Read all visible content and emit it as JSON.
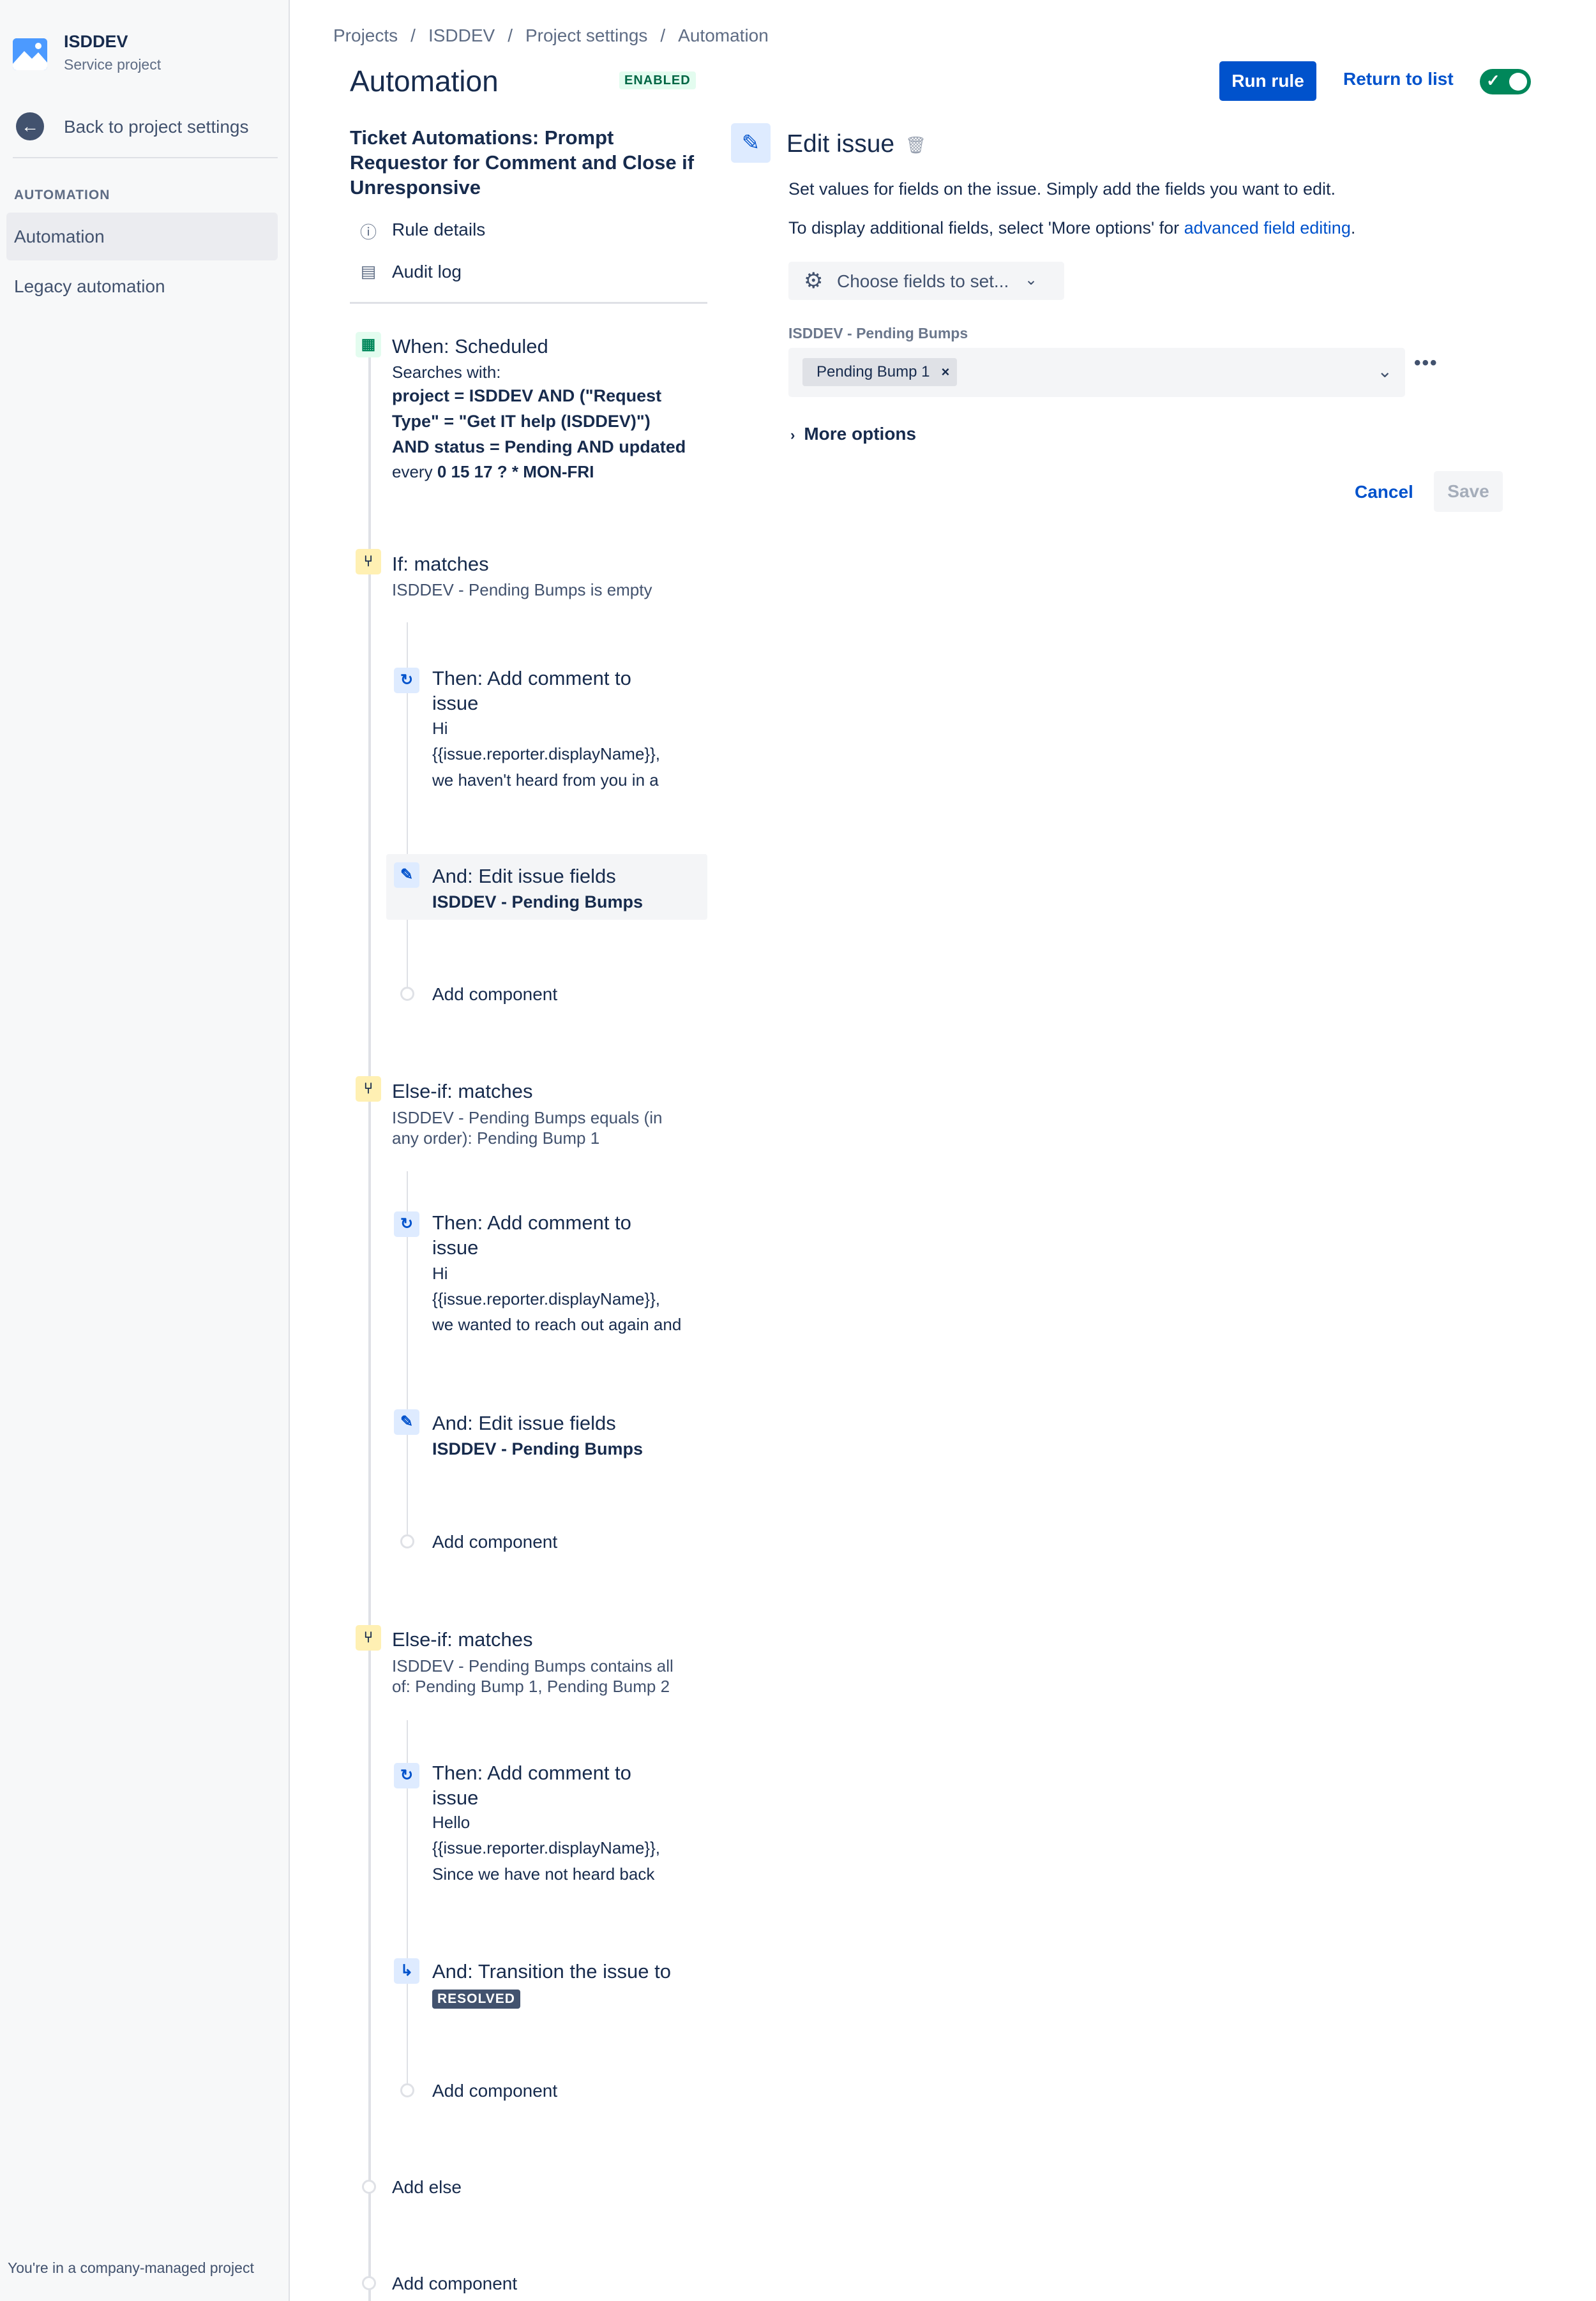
{
  "sidebar": {
    "project_name": "ISDDEV",
    "project_type": "Service project",
    "back_label": "Back to project settings",
    "section_label": "AUTOMATION",
    "items": [
      {
        "label": "Automation",
        "active": true
      },
      {
        "label": "Legacy automation",
        "active": false
      }
    ],
    "footer": "You're in a company-managed project"
  },
  "breadcrumbs": [
    "Projects",
    "ISDDEV",
    "Project settings",
    "Automation"
  ],
  "header": {
    "title": "Automation",
    "status_badge": "ENABLED",
    "run_rule_label": "Run rule",
    "return_label": "Return to list",
    "toggle_on": true
  },
  "rule": {
    "name": "Ticket Automations: Prompt Requestor for Comment and Close if Unresponsive",
    "meta": [
      {
        "icon": "info-icon",
        "label": "Rule details"
      },
      {
        "icon": "audit-log-icon",
        "label": "Audit log"
      }
    ],
    "trigger": {
      "title": "When: Scheduled",
      "searches_label": "Searches with:",
      "jql_line1": "project = ISDDEV AND (\"Request",
      "jql_line2": "Type\" = \"Get IT help (ISDDEV)\")",
      "jql_line3": "AND status = Pending AND updated",
      "every_prefix": "every",
      "cron": "0 15 17 ? * MON-FRI"
    },
    "branch1": {
      "title": "If: matches",
      "desc": "ISDDEV - Pending Bumps is empty",
      "action1_title_1": "Then: Add comment to",
      "action1_title_2": "issue",
      "action1_l1": "Hi",
      "action1_l2": "{{issue.reporter.displayName}},",
      "action1_l3": "we haven't heard from you in a",
      "action2_title": "And: Edit issue fields",
      "action2_field": "ISDDEV - Pending Bumps",
      "add_component": "Add component"
    },
    "branch2": {
      "title": "Else-if: matches",
      "desc_1": "ISDDEV - Pending Bumps equals (in",
      "desc_2": "any order): Pending Bump 1",
      "action1_title_1": "Then: Add comment to",
      "action1_title_2": "issue",
      "action1_l1": "Hi",
      "action1_l2": "{{issue.reporter.displayName}},",
      "action1_l3": "we wanted to reach out again and",
      "action2_title": "And: Edit issue fields",
      "action2_field": "ISDDEV - Pending Bumps",
      "add_component": "Add component"
    },
    "branch3": {
      "title": "Else-if: matches",
      "desc_1": "ISDDEV - Pending Bumps contains all",
      "desc_2": "of: Pending Bump 1, Pending Bump 2",
      "action1_title_1": "Then: Add comment to",
      "action1_title_2": "issue",
      "action1_l1": "Hello",
      "action1_l2": "{{issue.reporter.displayName}},",
      "action1_l3": "Since we have not heard back",
      "action2_title": "And: Transition the issue to",
      "action2_status": "RESOLVED",
      "add_component": "Add component"
    },
    "add_else": "Add else",
    "add_component_root": "Add component"
  },
  "edit_panel": {
    "title": "Edit issue",
    "desc1": "Set values for fields on the issue. Simply add the fields you want to edit.",
    "desc2_prefix": "To display additional fields, select 'More options' for ",
    "desc2_link": "advanced field editing",
    "desc2_suffix": ".",
    "choose_fields_label": "Choose fields to set...",
    "field_label": "ISDDEV - Pending Bumps",
    "field_value_chip": "Pending Bump 1",
    "more_options_label": "More options",
    "cancel_label": "Cancel",
    "save_label": "Save"
  },
  "colors": {
    "primary": "#0052cc",
    "toggle_on": "#00875a",
    "enabled_badge_bg": "#e3fcef",
    "enabled_badge_text": "#006644"
  }
}
